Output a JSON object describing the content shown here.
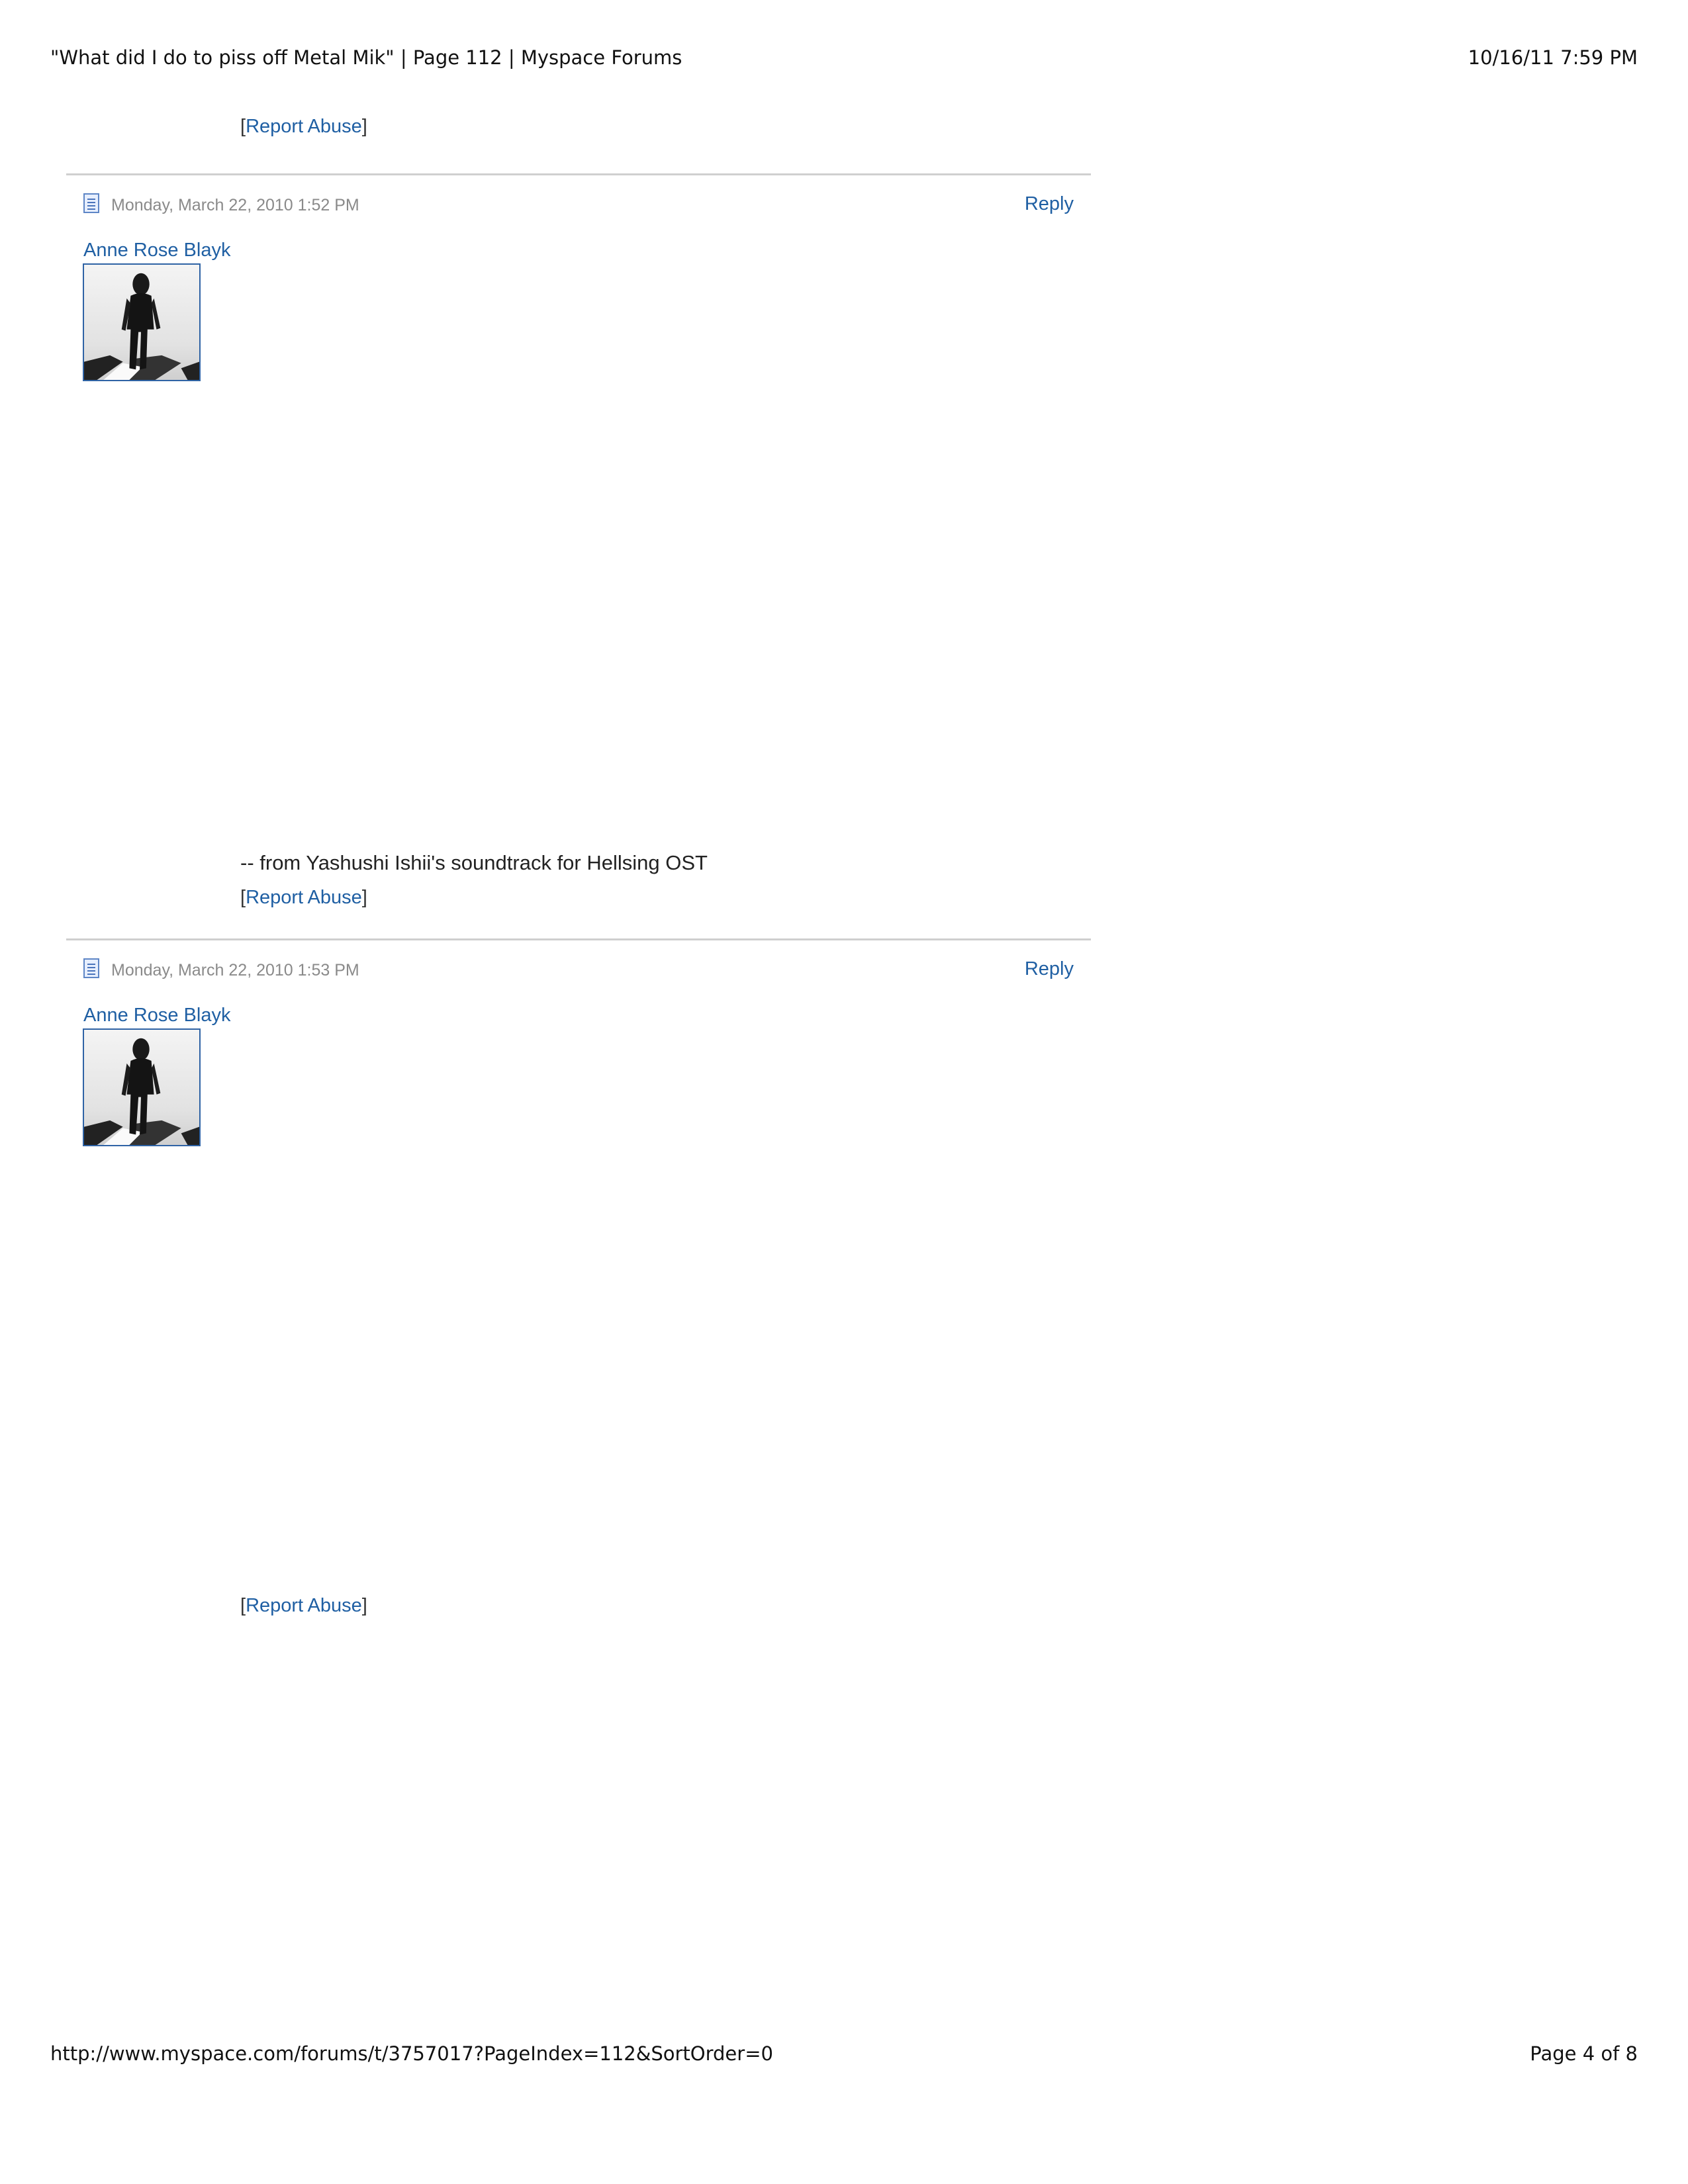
{
  "print_header": {
    "title": "\"What did I do to piss off Metal Mik\" | Page 112 | Myspace Forums",
    "datetime": "10/16/11 7:59 PM"
  },
  "print_footer": {
    "url": "http://www.myspace.com/forums/t/3757017?PageIndex=112&SortOrder=0",
    "page": "Page 4 of 8"
  },
  "report_abuse_label": "Report Abuse",
  "posts": [
    {
      "date": "Monday, March 22, 2010 1:52 PM",
      "reply_label": "Reply",
      "author": "Anne Rose Blayk",
      "body": "-- from Yashushi Ishii's soundtrack for Hellsing OST"
    },
    {
      "date": "Monday, March 22, 2010 1:53 PM",
      "reply_label": "Reply",
      "author": "Anne Rose Blayk",
      "body": ""
    }
  ],
  "icons": {
    "post": "document-icon",
    "avatar": "avatar-image"
  }
}
